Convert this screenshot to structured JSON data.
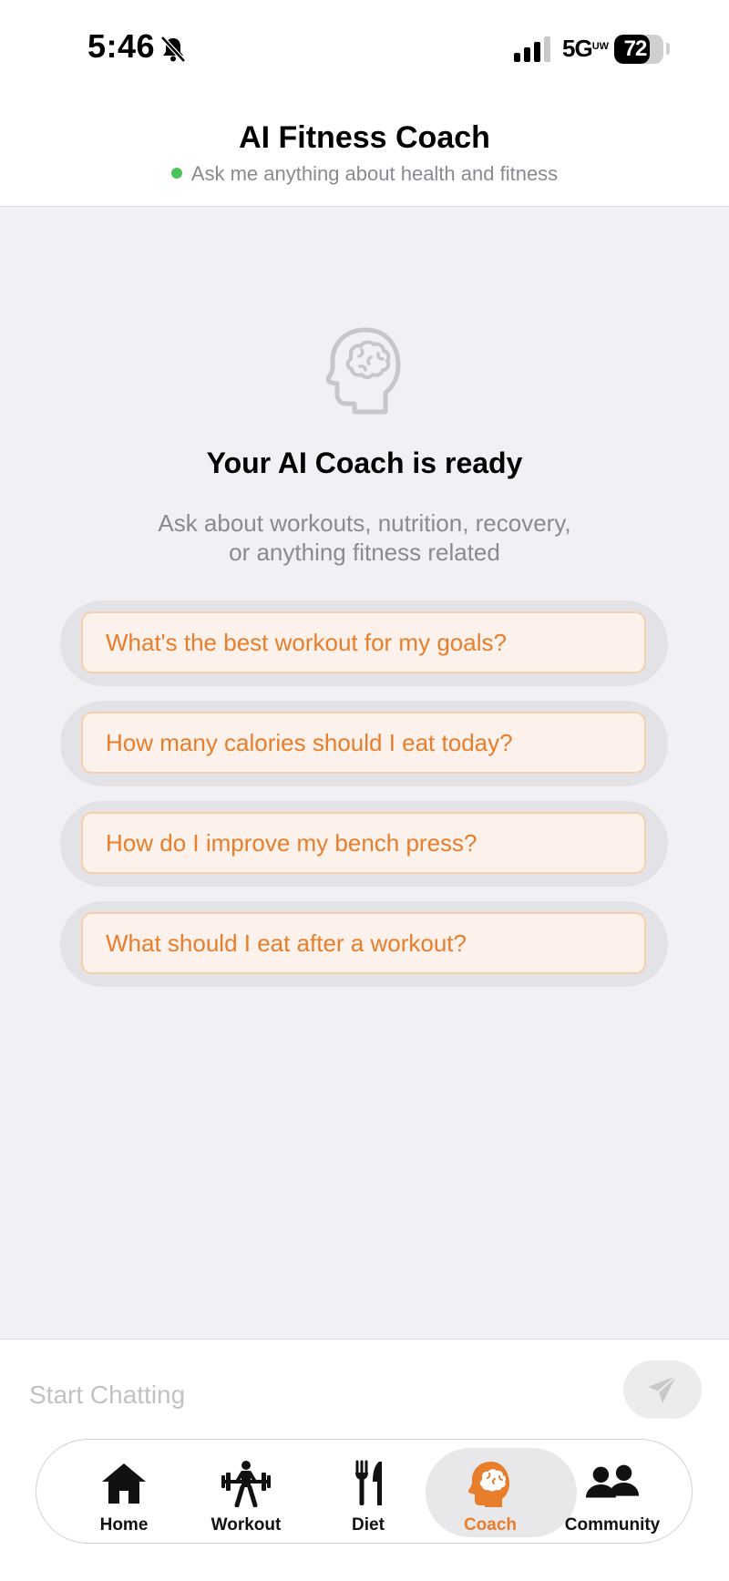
{
  "status_bar": {
    "time": "5:46",
    "network": "5G",
    "network_suffix": "UW",
    "battery": "72",
    "battery_level": 0.72
  },
  "header": {
    "title": "AI Fitness Coach",
    "subtitle": "Ask me anything about health and fitness"
  },
  "empty_state": {
    "title": "Your AI Coach is ready",
    "description_line1": "Ask about workouts, nutrition, recovery,",
    "description_line2": "or anything fitness related"
  },
  "suggestions": [
    "What's the best workout for my goals?",
    "How many calories should I eat today?",
    "How do I improve my bench press?",
    "What should I eat after a workout?"
  ],
  "chat": {
    "placeholder": "Start Chatting"
  },
  "tabs": [
    {
      "label": "Home",
      "icon": "home-icon"
    },
    {
      "label": "Workout",
      "icon": "weightlifter-icon"
    },
    {
      "label": "Diet",
      "icon": "fork-knife-icon"
    },
    {
      "label": "Coach",
      "icon": "brain-head-icon",
      "active": true
    },
    {
      "label": "Community",
      "icon": "people-icon"
    }
  ],
  "colors": {
    "accent": "#e87d2c",
    "online": "#4cc25a",
    "background": "#f0f0f5"
  }
}
